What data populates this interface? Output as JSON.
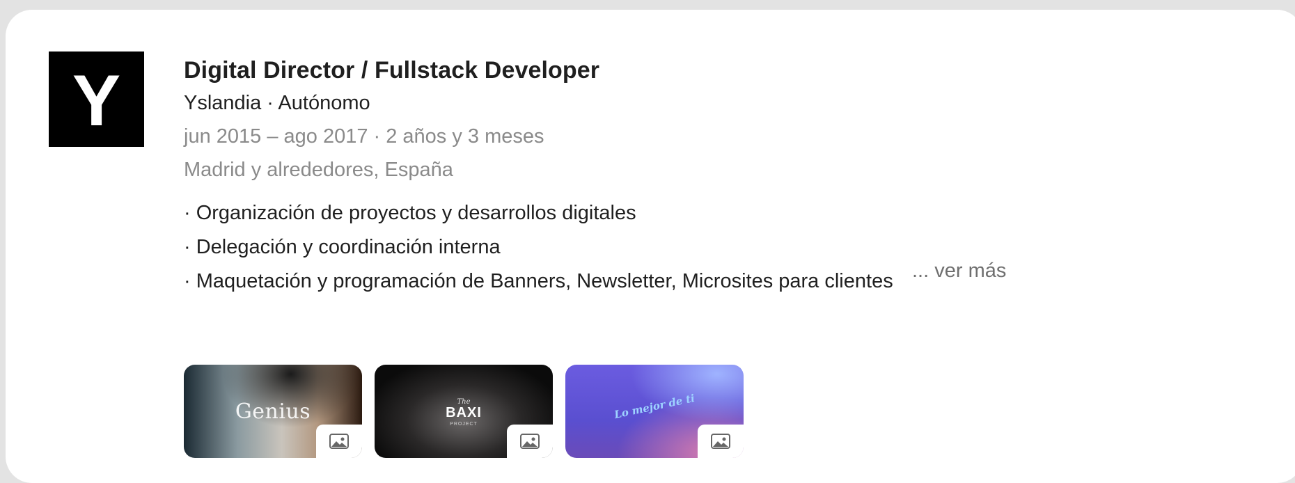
{
  "logo": {
    "letter": "Y"
  },
  "experience": {
    "title": "Digital Director / Fullstack Developer",
    "company_line": "Yslandia · Autónomo",
    "date_line": "jun 2015 – ago 2017 · 2 años y 3 meses",
    "location": "Madrid y alrededores, España",
    "description": [
      "· Organización de proyectos y desarrollos digitales",
      "· Delegación y coordinación interna",
      "· Maquetación y programación de Banners, Newsletter, Microsites para clientes"
    ],
    "see_more": "... ver más"
  },
  "media": [
    {
      "text": "Genius",
      "icon": "image-icon"
    },
    {
      "text_small": "The",
      "text": "BAXI",
      "text_sub": "PROJECT",
      "icon": "image-icon"
    },
    {
      "text": "Lo mejor de ti",
      "icon": "image-icon"
    }
  ],
  "colors": {
    "background": "#e3e3e3",
    "card": "#ffffff",
    "text_primary": "#1f1f1f",
    "text_secondary": "#8a8a8a",
    "logo_bg": "#000000"
  }
}
